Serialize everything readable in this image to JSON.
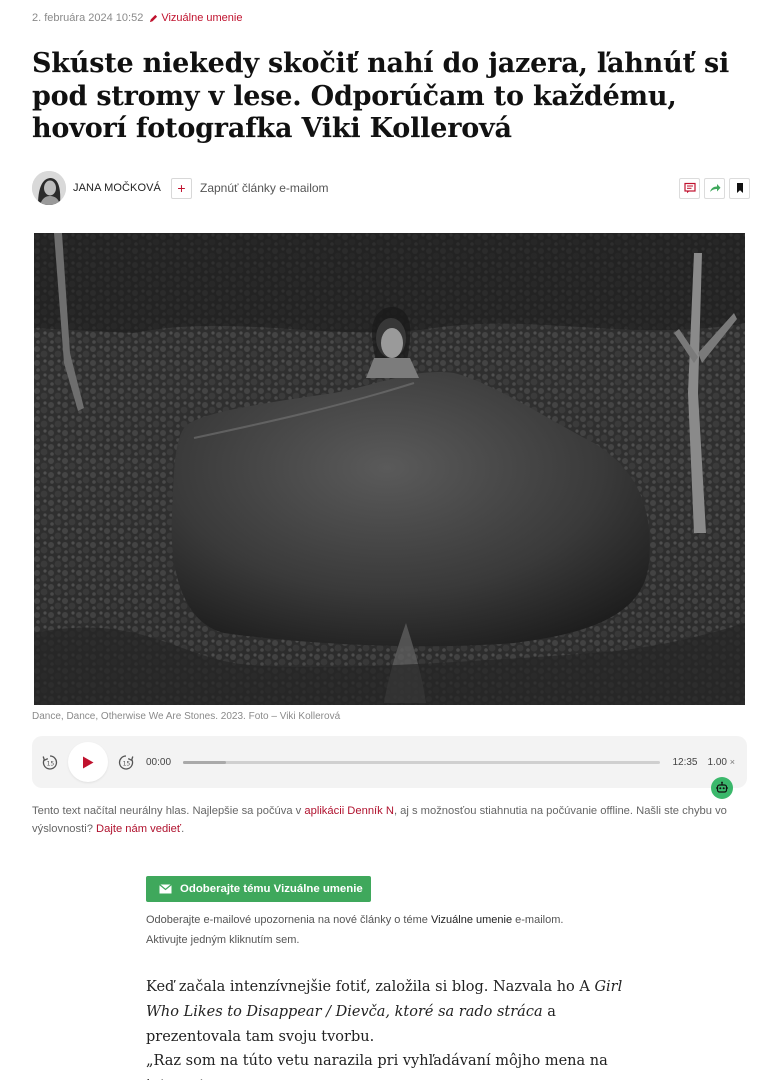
{
  "meta": {
    "date": "2. februára 2024 10:52",
    "category": "Vizuálne umenie"
  },
  "article": {
    "title": "Skúste niekedy skočiť nahí do jazera, ľahnúť si pod stromy v lese. Odporúčam to každému, hovorí fotografka Viki Kollerová"
  },
  "byline": {
    "author": "JANA MOČKOVÁ",
    "follow_icon": "+",
    "follow_text": "Zapnúť články e-mailom",
    "icons": [
      "comment-icon",
      "share-icon",
      "bookmark-icon"
    ]
  },
  "photo": {
    "caption": "Dance, Dance, Otherwise We Are Stones. 2023. Foto – Viki Kollerová"
  },
  "player": {
    "current_time": "00:00",
    "total_time": "12:35",
    "speed": "1.00",
    "speed_suffix": "×",
    "progress": 0.09,
    "icons": [
      "rewind-15-icon",
      "play-icon",
      "forward-15-icon",
      "robot-icon"
    ]
  },
  "tts_note": {
    "t1": "Tento text načítal neurálny hlas. Najlepšie sa počúva v ",
    "link1": "aplikácii Denník N",
    "t2": ", aj s možnosťou stiahnutia na počúvanie offline. Našli ste chybu vo výslovnosti? ",
    "link2": "Dajte nám vedieť",
    "t3": "."
  },
  "subscribe": {
    "button_label": "Odoberajte tému Vizuálne umenie",
    "note_1": "Odoberajte e-mailové upozornenia na nové články o téme ",
    "note_topic": "Vizuálne umenie",
    "note_2": " e-mailom.",
    "note_3": "Aktivujte jedným kliknutím sem."
  },
  "body": {
    "p1_a": "Keď začala intenzívnejšie fotiť, založila si blog. Nazvala ho A ",
    "p1_b": "Girl Who Likes to Disappear / Dievča, ktoré sa rado stráca",
    "p1_c": " a prezentovala tam svoju tvorbu.",
    "p2": "„Raz som na túto vetu narazila pri vyhľadávaní môjho mena na internete"
  },
  "colors": {
    "accent": "#c0122e",
    "subscribe_green": "#3fa85c",
    "robot_green": "#3ab86b"
  }
}
